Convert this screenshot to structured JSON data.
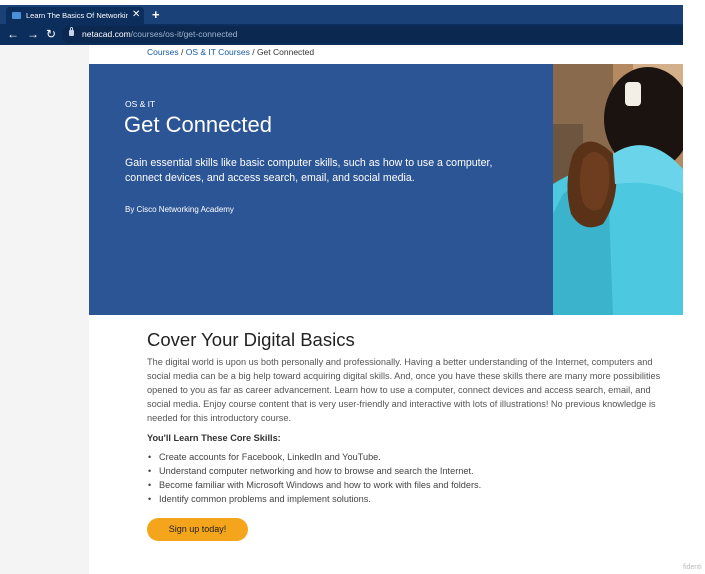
{
  "browser": {
    "tab_title": "Learn The Basics Of Networking :",
    "tab_close": "✕",
    "new_tab": "+",
    "back": "←",
    "forward": "→",
    "reload": "↻",
    "url_host": "netacad.com",
    "url_path": "/courses/os-it/get-connected"
  },
  "breadcrumb": {
    "items": [
      "Courses",
      "OS & IT Courses",
      "Get Connected"
    ],
    "separator": " / "
  },
  "hero": {
    "eyebrow": "OS & IT",
    "title": "Get Connected",
    "description": "Gain essential skills like basic computer skills, such as how to use a computer, connect devices, and access search, email, and social media.",
    "byline": "By Cisco Networking Academy",
    "background": "#2c5596"
  },
  "content": {
    "title": "Cover Your Digital Basics",
    "body": "The digital world is upon us both personally and professionally. Having a better understanding of the Internet, computers and social media can be a big help toward acquiring digital skills. And, once you have these skills there are many more possibilities opened to you as far as career advancement. Learn how to use a computer, connect devices and access search, email, and social media. Enjoy course content that is very user-friendly and interactive with lots of illustrations! No previous knowledge is needed for this introductory course.",
    "skills_heading": "You'll Learn These Core Skills:",
    "skills": [
      "Create accounts for Facebook, LinkedIn and YouTube.",
      "Understand computer networking and how to browse and search the Internet.",
      "Become familiar with Microsoft Windows and how to work with files and folders.",
      "Identify common problems and implement solutions."
    ],
    "cta_label": "Sign up today!",
    "cta_color": "#f5a51c"
  },
  "watermark": "fidenti"
}
